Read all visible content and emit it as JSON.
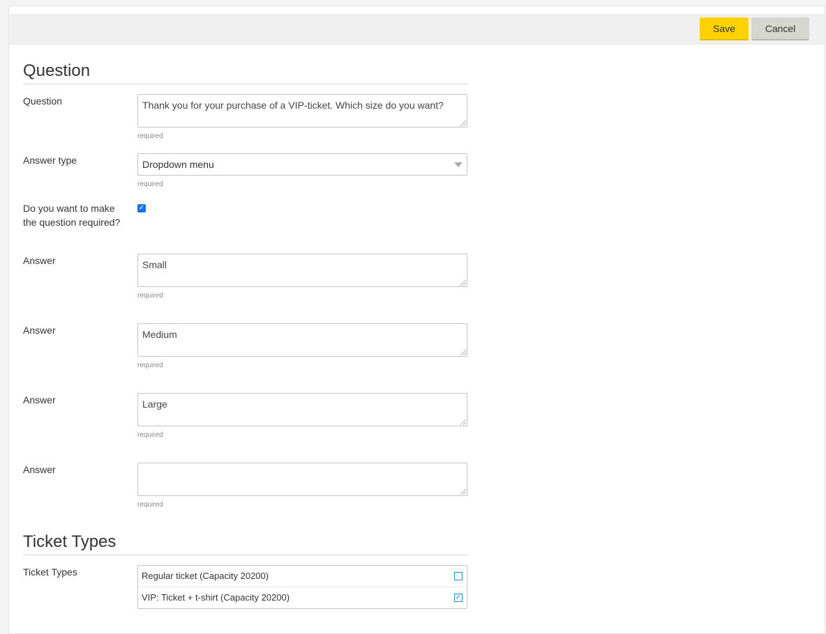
{
  "toolbar": {
    "save_label": "Save",
    "cancel_label": "Cancel",
    "save_color": "#ffd200",
    "cancel_color": "#d6d6d0"
  },
  "question_section": {
    "title": "Question",
    "question_label": "Question",
    "question_value": "Thank you for your purchase of a VIP-ticket. Which size do you want?",
    "question_hint": "required",
    "answer_type_label": "Answer type",
    "answer_type_value": "Dropdown menu",
    "answer_type_hint": "required",
    "required_label": "Do you want to make the question required?",
    "required_checked": true,
    "answers": [
      {
        "label": "Answer",
        "value": "Small",
        "hint": "required"
      },
      {
        "label": "Answer",
        "value": "Medium",
        "hint": "required"
      },
      {
        "label": "Answer",
        "value": "Large",
        "hint": "required"
      },
      {
        "label": "Answer",
        "value": "",
        "hint": "required"
      }
    ]
  },
  "ticket_types_section": {
    "title": "Ticket Types",
    "label": "Ticket Types",
    "items": [
      {
        "label": "Regular ticket (Capacity 20200)",
        "checked": false
      },
      {
        "label": "VIP: Ticket + t-shirt (Capacity 20200)",
        "checked": true
      }
    ]
  },
  "icons": {
    "dropdown": "chevron-down-icon",
    "checkbox": "checkmark-icon"
  }
}
